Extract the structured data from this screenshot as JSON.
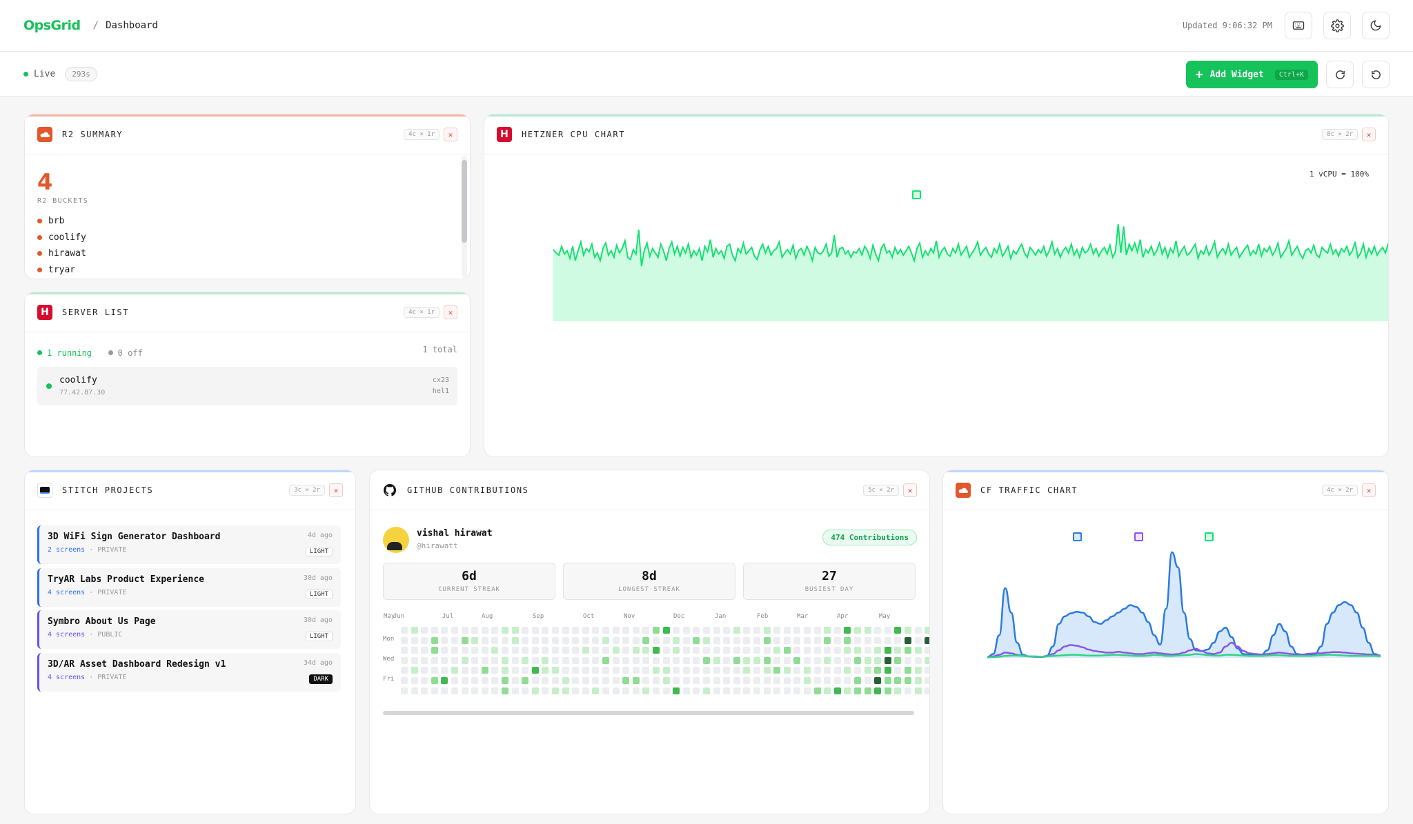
{
  "header": {
    "logo": "OpsGrid",
    "breadcrumb_sep": "/",
    "breadcrumb": "Dashboard",
    "updated": "Updated 9:06:32 PM"
  },
  "subbar": {
    "live_label": "Live",
    "timer": "293s",
    "add_label": "Add Widget",
    "add_shortcut": "Ctrl+K"
  },
  "colors": {
    "accent": "#16c25a",
    "cloudflare": "#e2572b",
    "hetzner": "#d50c2d",
    "stitch_blue": "#2b6ef2",
    "stitch_purple": "#6b4cf0"
  },
  "r2": {
    "title": "R2 SUMMARY",
    "size": "4c × 1r",
    "count": "4",
    "count_label": "R2 BUCKETS",
    "buckets": [
      "brb",
      "coolify",
      "hirawat",
      "tryar"
    ]
  },
  "servers": {
    "title": "SERVER LIST",
    "size": "4c × 1r",
    "running": "1 running",
    "off": "0 off",
    "total": "1 total",
    "items": [
      {
        "name": "coolify",
        "ip": "77.42.87.30",
        "type": "cx23",
        "loc": "hel1"
      }
    ]
  },
  "cpu": {
    "title": "HETZNER CPU CHART",
    "size": "8c × 2r",
    "note": "1 vCPU = 100%"
  },
  "stitch": {
    "title": "STITCH PROJECTS",
    "size": "3c × 2r",
    "projects": [
      {
        "name": "3D WiFi Sign Generator Dashboard",
        "screens": "2 screens",
        "vis": "PRIVATE",
        "ago": "4d ago",
        "theme": "LIGHT"
      },
      {
        "name": "TryAR Labs Product Experience",
        "screens": "4 screens",
        "vis": "PRIVATE",
        "ago": "30d ago",
        "theme": "LIGHT"
      },
      {
        "name": "Symbro About Us Page",
        "screens": "4 screens",
        "vis": "PUBLIC",
        "ago": "30d ago",
        "theme": "LIGHT"
      },
      {
        "name": "3D/AR Asset Dashboard Redesign v1",
        "screens": "4 screens",
        "vis": "PRIVATE",
        "ago": "34d ago",
        "theme": "DARK"
      }
    ],
    "sep": "·"
  },
  "github": {
    "title": "GITHUB CONTRIBUTIONS",
    "size": "5c × 2r",
    "user": "vishal hirawat",
    "handle": "@hirawatt",
    "total": "474 Contributions",
    "stats": [
      {
        "value": "6d",
        "label": "CURRENT STREAK"
      },
      {
        "value": "8d",
        "label": "LONGEST STREAK"
      },
      {
        "value": "27",
        "label": "BUSIEST DAY"
      }
    ],
    "months": [
      "May",
      "Jun",
      "Jul",
      "Aug",
      "Sep",
      "Oct",
      "Nov",
      "Dec",
      "Jan",
      "Feb",
      "Mar",
      "Apr",
      "May"
    ],
    "days": [
      "Mon",
      "Wed",
      "Fri"
    ]
  },
  "cf": {
    "title": "CF TRAFFIC CHART",
    "size": "4c × 2r"
  },
  "chart_data": [
    {
      "type": "area",
      "series": [
        {
          "values": [
            65,
            62,
            60,
            68,
            61,
            64,
            57,
            68,
            55,
            64,
            72,
            60,
            66,
            63,
            70,
            58,
            62,
            55,
            66,
            71,
            60,
            64,
            58,
            69,
            62,
            66,
            73,
            58,
            56,
            65,
            61,
            83,
            50,
            64,
            71,
            59,
            66,
            62,
            58,
            70,
            64,
            55,
            66,
            72,
            61,
            68,
            59,
            67,
            62,
            70,
            58,
            64,
            60,
            66,
            55,
            68,
            63,
            74,
            58,
            66,
            61,
            64,
            57,
            68,
            70,
            60,
            55,
            66,
            62,
            71,
            61,
            64,
            67,
            59,
            56,
            65,
            70,
            62,
            68,
            60,
            64,
            66,
            72,
            58,
            62,
            65,
            61,
            69,
            57,
            64,
            66,
            60,
            68,
            63,
            55,
            67,
            62,
            61,
            64,
            70,
            59,
            62,
            78,
            58,
            66,
            67,
            61,
            64,
            58,
            63,
            62,
            66,
            60,
            68,
            64,
            57,
            69,
            61,
            55,
            66,
            70,
            62,
            64,
            58,
            67,
            61,
            65,
            60,
            64,
            68,
            62,
            55,
            66,
            71,
            58,
            64,
            60,
            66,
            62,
            73,
            58,
            64,
            67,
            61,
            59,
            66,
            62,
            70,
            60,
            64,
            68,
            58,
            62,
            66,
            72,
            60,
            64,
            67,
            61,
            58,
            66,
            62,
            70,
            59,
            63,
            68,
            57,
            64,
            61,
            66,
            70,
            62,
            58,
            67,
            64,
            60,
            65,
            62,
            68,
            59,
            64,
            72,
            61,
            66,
            58,
            64,
            67,
            62,
            70,
            60,
            65,
            58,
            67,
            62,
            64,
            70,
            61,
            66,
            59,
            64,
            67,
            61,
            69,
            58,
            63,
            88,
            62,
            86,
            60,
            70,
            64,
            71,
            63,
            74,
            58,
            65,
            62,
            68,
            60,
            64,
            71,
            61,
            67,
            58,
            66,
            62,
            73,
            59,
            64,
            68,
            60,
            62,
            66,
            70,
            57,
            64,
            61,
            68,
            60,
            65,
            72,
            58,
            63,
            66,
            61,
            70,
            60,
            64,
            67,
            58,
            62,
            66,
            69,
            60,
            64,
            61,
            70,
            59,
            66,
            63,
            68,
            60,
            64,
            71,
            58,
            62,
            66,
            73,
            60,
            64,
            68,
            61,
            57,
            64,
            66,
            62,
            69,
            60,
            58,
            67,
            64,
            62,
            70,
            61,
            65,
            59,
            66,
            63,
            68,
            60,
            64,
            72,
            58,
            62,
            70,
            58,
            66,
            61,
            68,
            60,
            64,
            67,
            62,
            70,
            59,
            64
          ]
        }
      ]
    },
    {
      "type": "area",
      "series": [
        {
          "values": [
            2,
            10,
            60,
            185,
            120,
            40,
            8,
            4,
            3,
            2,
            5,
            30,
            90,
            110,
            118,
            122,
            120,
            110,
            95,
            90,
            100,
            110,
            120,
            130,
            140,
            135,
            120,
            95,
            60,
            35,
            130,
            280,
            240,
            120,
            50,
            20,
            18,
            22,
            40,
            70,
            80,
            55,
            25,
            10,
            8,
            6,
            8,
            20,
            60,
            90,
            70,
            30,
            10,
            8,
            7,
            9,
            30,
            90,
            120,
            140,
            148,
            140,
            120,
            80,
            40,
            10,
            6
          ]
        },
        {
          "values": [
            2,
            4,
            8,
            14,
            12,
            8,
            5,
            4,
            3,
            2,
            4,
            10,
            20,
            30,
            34,
            32,
            28,
            22,
            18,
            16,
            14,
            14,
            16,
            14,
            12,
            10,
            10,
            12,
            14,
            12,
            10,
            9,
            10,
            14,
            20,
            24,
            18,
            12,
            10,
            14,
            30,
            40,
            30,
            18,
            12,
            10,
            9,
            10,
            12,
            14,
            12,
            10,
            8,
            9,
            11,
            12,
            12,
            14,
            15,
            15,
            14,
            12,
            11,
            10,
            9,
            8,
            6
          ]
        },
        {
          "values": [
            1,
            2,
            3,
            5,
            6,
            6,
            5,
            4,
            4,
            3,
            4,
            5,
            6,
            7,
            8,
            8,
            7,
            6,
            6,
            6,
            7,
            8,
            8,
            7,
            6,
            5,
            5,
            6,
            8,
            7,
            5,
            5,
            6,
            7,
            8,
            10,
            9,
            7,
            6,
            6,
            8,
            8,
            7,
            6,
            5,
            5,
            5,
            6,
            7,
            7,
            6,
            5,
            5,
            5,
            5,
            6,
            7,
            8,
            8,
            7,
            6,
            5,
            5,
            5,
            5,
            5,
            4
          ]
        }
      ]
    }
  ]
}
